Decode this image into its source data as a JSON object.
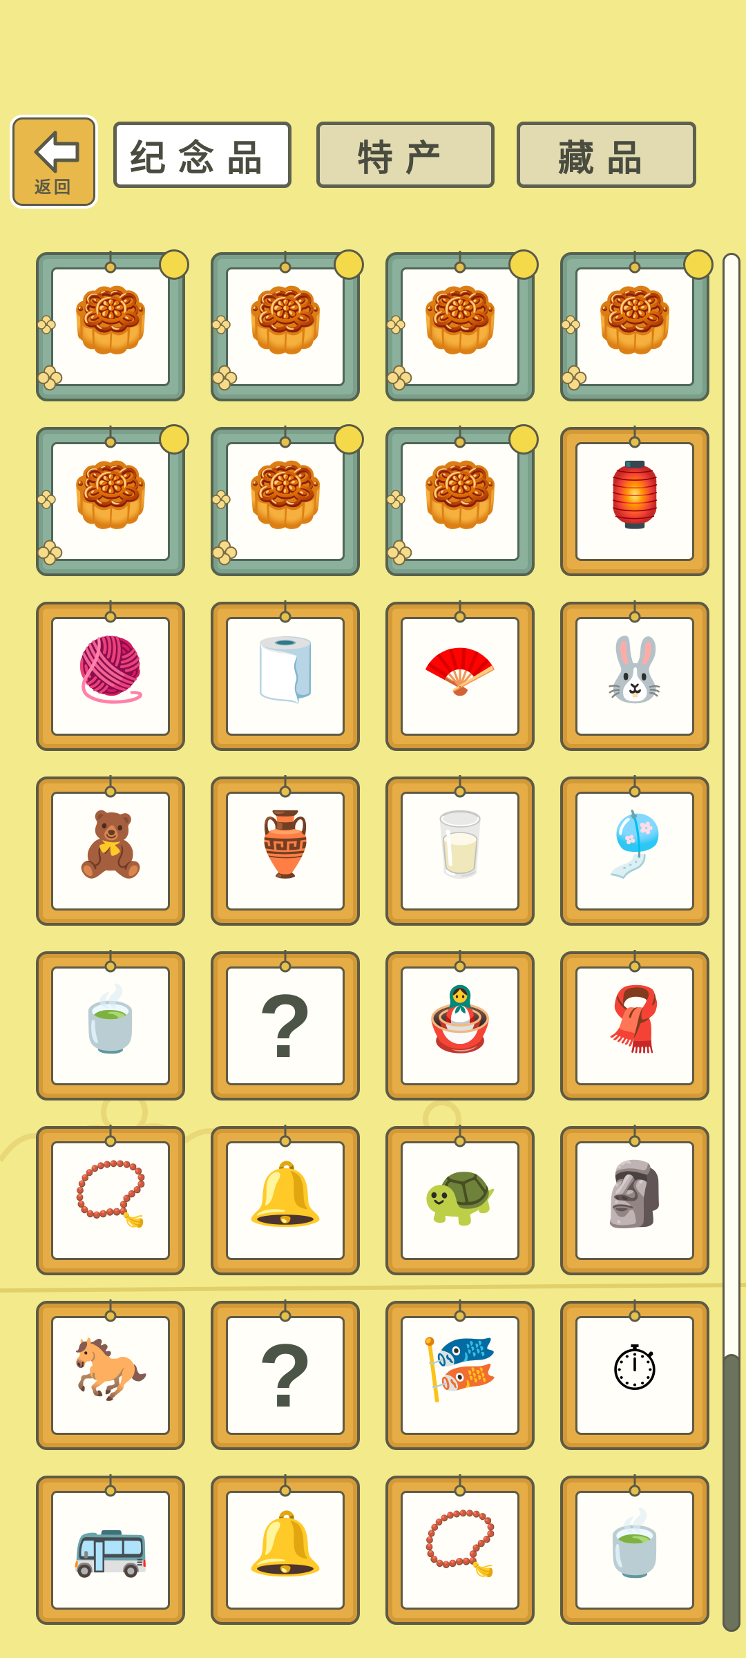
{
  "header": {
    "back_label": "返回",
    "tabs": [
      {
        "label": "纪念品",
        "active": true
      },
      {
        "label": "特产",
        "active": false
      },
      {
        "label": "藏品",
        "active": false
      }
    ]
  },
  "items": [
    {
      "icon": "mooncake-black-sesame-icon",
      "glyph": "🥮",
      "frame": "teal"
    },
    {
      "icon": "mooncake-red-bean-icon",
      "glyph": "🥮",
      "frame": "teal"
    },
    {
      "icon": "mooncake-lotus-icon",
      "glyph": "🥮",
      "frame": "teal"
    },
    {
      "icon": "mooncake-egg-yolk-icon",
      "glyph": "🥮",
      "frame": "teal"
    },
    {
      "icon": "mooncake-green-tea-icon",
      "glyph": "🥮",
      "frame": "teal"
    },
    {
      "icon": "mooncake-date-icon",
      "glyph": "🥮",
      "frame": "teal"
    },
    {
      "icon": "mooncake-custard-icon",
      "glyph": "🥮",
      "frame": "teal"
    },
    {
      "icon": "embroidery-screen-icon",
      "glyph": "🏮",
      "frame": "gold"
    },
    {
      "icon": "embroidered-ball-icon",
      "glyph": "🧶",
      "frame": "gold"
    },
    {
      "icon": "silk-cloth-icon",
      "glyph": "🧻",
      "frame": "gold"
    },
    {
      "icon": "round-fan-icon",
      "glyph": "🪭",
      "frame": "gold"
    },
    {
      "icon": "rabbit-opera-doll-icon",
      "glyph": "🐰",
      "frame": "gold"
    },
    {
      "icon": "clay-figurine-icon",
      "glyph": "🧸",
      "frame": "gold"
    },
    {
      "icon": "glazed-jar-icon",
      "glyph": "🏺",
      "frame": "gold"
    },
    {
      "icon": "bamboo-cup-icon",
      "glyph": "🥛",
      "frame": "gold"
    },
    {
      "icon": "porcelain-charm-icon",
      "glyph": "🎐",
      "frame": "gold"
    },
    {
      "icon": "matcha-powder-icon",
      "glyph": "🍵",
      "frame": "gold"
    },
    {
      "icon": "unknown-item-icon",
      "glyph": "?",
      "frame": "gold",
      "unknown": true
    },
    {
      "icon": "matryoshka-doll-icon",
      "glyph": "🪆",
      "frame": "gold"
    },
    {
      "icon": "indigo-cloth-icon",
      "glyph": "🧣",
      "frame": "gold"
    },
    {
      "icon": "prayer-beads-icon",
      "glyph": "📿",
      "frame": "gold"
    },
    {
      "icon": "bian-zhong-bells-icon",
      "glyph": "🔔",
      "frame": "gold"
    },
    {
      "icon": "stone-turtle-icon",
      "glyph": "🐢",
      "frame": "gold"
    },
    {
      "icon": "terracotta-warrior-icon",
      "glyph": "🗿",
      "frame": "gold"
    },
    {
      "icon": "tang-horse-icon",
      "glyph": "🐎",
      "frame": "gold"
    },
    {
      "icon": "unknown-item-icon",
      "glyph": "?",
      "frame": "gold",
      "unknown": true
    },
    {
      "icon": "knot-tassel-icon",
      "glyph": "🎏",
      "frame": "gold"
    },
    {
      "icon": "pocket-watch-icon",
      "glyph": "⏱",
      "frame": "gold"
    },
    {
      "icon": "double-decker-bus-icon",
      "glyph": "🚌",
      "frame": "gold"
    },
    {
      "icon": "cow-bell-icon",
      "glyph": "🔔",
      "frame": "gold"
    },
    {
      "icon": "silver-necklace-icon",
      "glyph": "📿",
      "frame": "gold"
    },
    {
      "icon": "tea-bowl-icon",
      "glyph": "🍵",
      "frame": "gold"
    }
  ]
}
